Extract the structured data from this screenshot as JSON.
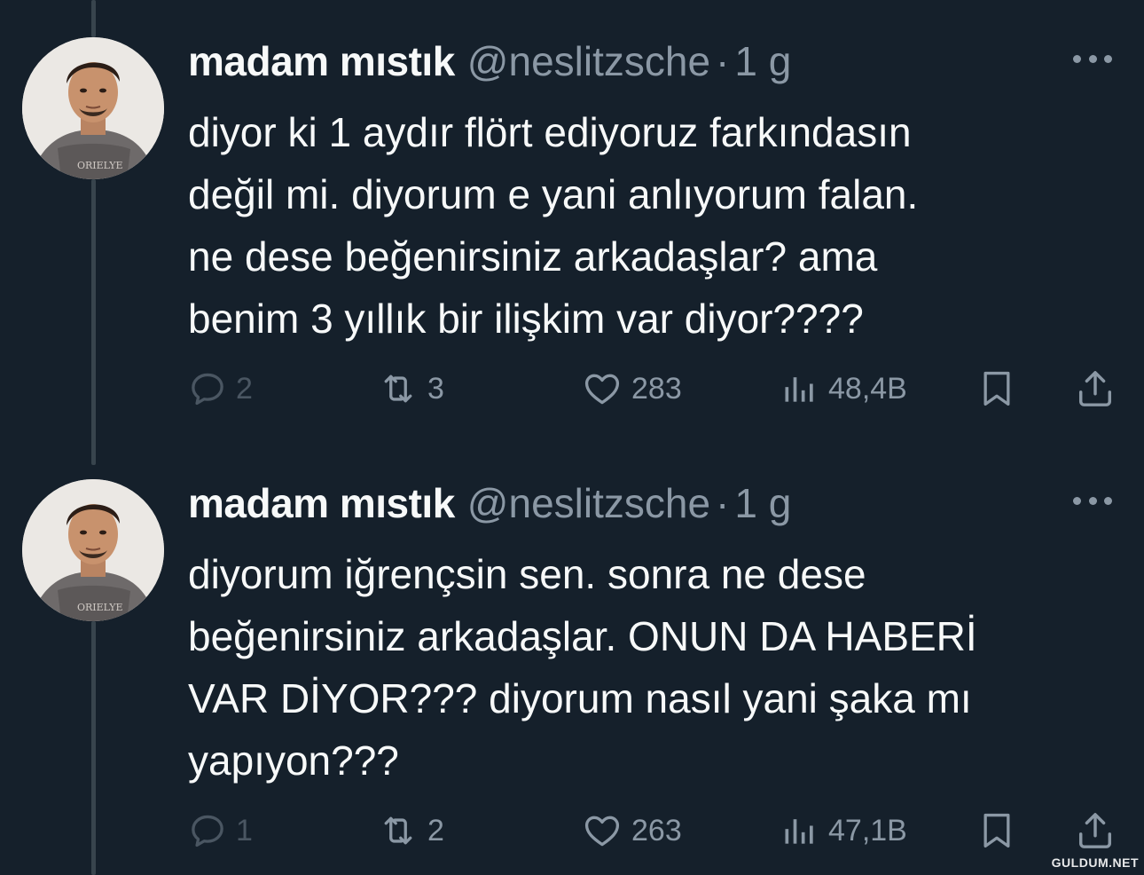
{
  "tweets": [
    {
      "author": {
        "name": "madam mıstık",
        "handle": "@neslitzsche",
        "separator": "·",
        "time": "1 g"
      },
      "lines": [
        "diyor ki 1 aydır flört ediyoruz farkındasın",
        "değil mi. diyorum e yani anlıyorum falan.",
        "ne dese beğenirsiniz arkadaşlar? ama",
        "benim 3 yıllık bir ilişkim var diyor????"
      ],
      "stats": {
        "replies": "2",
        "retweets": "3",
        "likes": "283",
        "views": "48,4B"
      }
    },
    {
      "author": {
        "name": "madam mıstık",
        "handle": "@neslitzsche",
        "separator": "·",
        "time": "1 g"
      },
      "lines": [
        "diyorum iğrençsin sen. sonra ne dese",
        "beğenirsiniz arkadaşlar. ONUN DA HABERİ",
        "VAR DİYOR??? diyorum nasıl yani şaka mı",
        "yapıyon???"
      ],
      "stats": {
        "replies": "1",
        "retweets": "2",
        "likes": "263",
        "views": "47,1B"
      }
    }
  ],
  "icons": {
    "reply": "reply-icon",
    "retweet": "retweet-icon",
    "like": "heart-icon",
    "views": "views-icon",
    "bookmark": "bookmark-icon",
    "share": "share-icon",
    "more": "more-icon"
  },
  "colors": {
    "background": "#15202b",
    "text": "#f7f9f9",
    "secondary": "#8b98a5",
    "thread_line": "#38444d"
  },
  "watermark": "GULDUM.NET"
}
